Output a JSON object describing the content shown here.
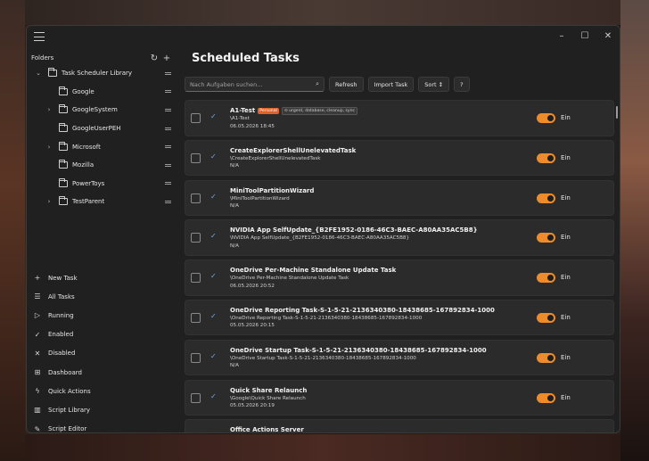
{
  "colors": {
    "accent": "#ee8b2a",
    "window_bg": "#202020",
    "card_bg": "#2b2b2b",
    "check": "#7aa7e8",
    "badge_personal": "#e0622a"
  },
  "window": {
    "controls": {
      "minimize": "–",
      "maximize": "☐",
      "close": "✕"
    }
  },
  "sidebar": {
    "folders_label": "Folders",
    "tree": [
      {
        "label": "Task Scheduler Library",
        "level": 0,
        "expandable": true,
        "expanded": true
      },
      {
        "label": "Google",
        "level": 1,
        "expandable": false
      },
      {
        "label": "GoogleSystem",
        "level": 1,
        "expandable": true
      },
      {
        "label": "GoogleUserPEH",
        "level": 1,
        "expandable": false
      },
      {
        "label": "Microsoft",
        "level": 1,
        "expandable": true
      },
      {
        "label": "Mozilla",
        "level": 1,
        "expandable": false
      },
      {
        "label": "PowerToys",
        "level": 1,
        "expandable": false
      },
      {
        "label": "TestParent",
        "level": 1,
        "expandable": true
      }
    ],
    "nav": [
      {
        "label": "New Task",
        "icon": "plus-icon",
        "glyph": "+"
      },
      {
        "label": "All Tasks",
        "icon": "list-icon",
        "glyph": "☰"
      },
      {
        "label": "Running",
        "icon": "play-icon",
        "glyph": "▷"
      },
      {
        "label": "Enabled",
        "icon": "check-icon",
        "glyph": "✓"
      },
      {
        "label": "Disabled",
        "icon": "x-icon",
        "glyph": "✕"
      },
      {
        "label": "Dashboard",
        "icon": "grid-icon",
        "glyph": "⊞"
      },
      {
        "label": "Quick Actions",
        "icon": "bolt-icon",
        "glyph": "ϟ"
      },
      {
        "label": "Script Library",
        "icon": "library-icon",
        "glyph": "▥"
      },
      {
        "label": "Script Editor",
        "icon": "pencil-icon",
        "glyph": "✎"
      },
      {
        "label": "Settings",
        "icon": "gear-icon",
        "glyph": "⚙"
      }
    ]
  },
  "main": {
    "title": "Scheduled Tasks",
    "search_placeholder": "Nach Aufgaben suchen...",
    "buttons": {
      "refresh": "Refresh",
      "import": "Import Task",
      "sort": "Sort ↕",
      "help": "?"
    },
    "tasks": [
      {
        "name": "A1-Test",
        "badges": [
          "Personal",
          "⊙ urgent, database, cleanup, sync"
        ],
        "path": "\\A1-Test",
        "date": "06.05.2026 18:45",
        "state": "Ein"
      },
      {
        "name": "CreateExplorerShellUnelevatedTask",
        "badges": [],
        "path": "\\CreateExplorerShellUnelevatedTask",
        "date": "N/A",
        "state": "Ein"
      },
      {
        "name": "MiniToolPartitionWizard",
        "badges": [],
        "path": "\\MiniToolPartitionWizard",
        "date": "N/A",
        "state": "Ein"
      },
      {
        "name": "NVIDIA App SelfUpdate_{B2FE1952-0186-46C3-BAEC-A80AA35AC5B8}",
        "badges": [],
        "path": "\\NVIDIA App SelfUpdate_{B2FE1952-0186-46C3-BAEC-A80AA35AC5B8}",
        "date": "N/A",
        "state": "Ein"
      },
      {
        "name": "OneDrive Per-Machine Standalone Update Task",
        "badges": [],
        "path": "\\OneDrive Per-Machine Standalone Update Task",
        "date": "06.05.2026 20:52",
        "state": "Ein"
      },
      {
        "name": "OneDrive Reporting Task-S-1-5-21-2136340380-18438685-167892834-1000",
        "badges": [],
        "path": "\\OneDrive Reporting Task-S-1-5-21-2136340380-18438685-167892834-1000",
        "date": "05.05.2026 20:15",
        "state": "Ein"
      },
      {
        "name": "OneDrive Startup Task-S-1-5-21-2136340380-18438685-167892834-1000",
        "badges": [],
        "path": "\\OneDrive Startup Task-S-1-5-21-2136340380-18438685-167892834-1000",
        "date": "N/A",
        "state": "Ein"
      },
      {
        "name": "Quick Share Relaunch",
        "badges": [],
        "path": "\\Google\\Quick Share Relaunch",
        "date": "05.05.2026 20:19",
        "state": "Ein"
      },
      {
        "name": "Office Actions Server",
        "badges": [],
        "path": "",
        "date": "",
        "state": ""
      }
    ]
  }
}
